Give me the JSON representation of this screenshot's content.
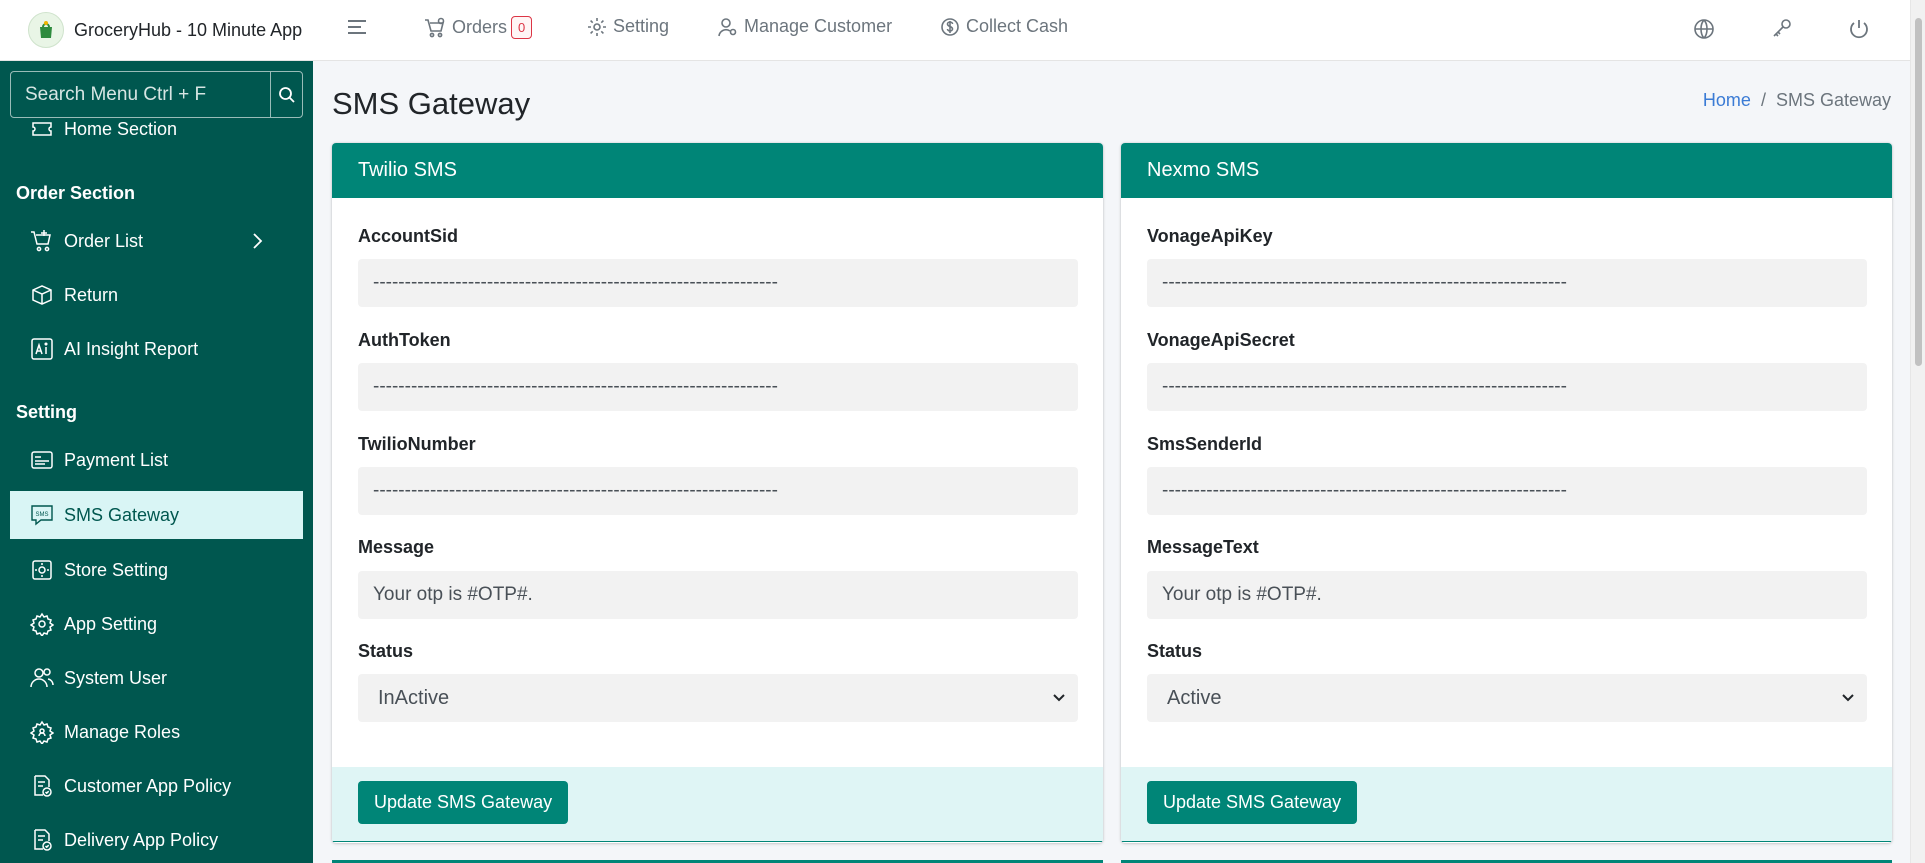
{
  "app": {
    "title": "GroceryHub - 10 Minute App"
  },
  "topnav": {
    "orders_label": "Orders",
    "orders_badge": "0",
    "setting_label": "Setting",
    "manage_customer_label": "Manage Customer",
    "collect_cash_label": "Collect Cash"
  },
  "sidebar": {
    "search_placeholder": "Search Menu Ctrl + F",
    "home_section": "Home Section",
    "order_heading": "Order Section",
    "order_items": [
      {
        "label": "Order List",
        "icon": "cart-icon"
      },
      {
        "label": "Return",
        "icon": "box-icon"
      },
      {
        "label": "AI Insight Report",
        "icon": "ai-icon"
      }
    ],
    "setting_heading": "Setting",
    "setting_items": [
      {
        "label": "Payment List",
        "icon": "card-icon"
      },
      {
        "label": "SMS Gateway",
        "icon": "sms-icon",
        "active": true
      },
      {
        "label": "Store Setting",
        "icon": "store-gear-icon"
      },
      {
        "label": "App Setting",
        "icon": "app-gear-icon"
      },
      {
        "label": "System User",
        "icon": "users-icon"
      },
      {
        "label": "Manage Roles",
        "icon": "roles-gear-icon"
      },
      {
        "label": "Customer App Policy",
        "icon": "policy-icon"
      },
      {
        "label": "Delivery App Policy",
        "icon": "policy-icon"
      }
    ]
  },
  "page": {
    "title": "SMS Gateway",
    "breadcrumb_home": "Home",
    "breadcrumb_sep": "/",
    "breadcrumb_current": "SMS Gateway"
  },
  "twilio": {
    "header": "Twilio SMS",
    "fields": [
      {
        "label": "AccountSid",
        "value": "----------------------------------------------------------------"
      },
      {
        "label": "AuthToken",
        "value": "----------------------------------------------------------------"
      },
      {
        "label": "TwilioNumber",
        "value": "----------------------------------------------------------------"
      },
      {
        "label": "Message",
        "value": "Your otp is #OTP#."
      }
    ],
    "status_label": "Status",
    "status_value": "InActive",
    "button": "Update SMS Gateway"
  },
  "nexmo": {
    "header": "Nexmo SMS",
    "fields": [
      {
        "label": "VonageApiKey",
        "value": "----------------------------------------------------------------"
      },
      {
        "label": "VonageApiSecret",
        "value": "----------------------------------------------------------------"
      },
      {
        "label": "SmsSenderId",
        "value": "----------------------------------------------------------------"
      },
      {
        "label": "MessageText",
        "value": "Your otp is #OTP#."
      }
    ],
    "status_label": "Status",
    "status_value": "Active",
    "button": "Update SMS Gateway"
  },
  "colors": {
    "sidebar": "#00574f",
    "accent": "#008577",
    "active_bg": "#d9f5f5",
    "footer_bg": "#dff5f5"
  }
}
